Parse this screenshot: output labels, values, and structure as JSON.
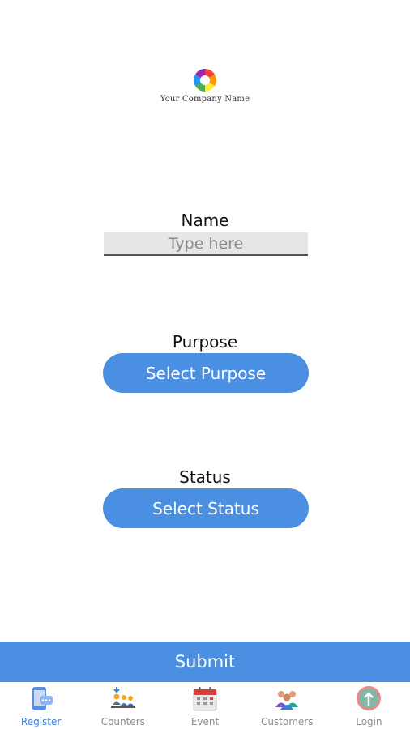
{
  "brand": {
    "company_name": "Your Company Name",
    "logo_icon": "aperture-logo-icon"
  },
  "form": {
    "name_label": "Name",
    "name_placeholder": "Type here",
    "purpose_label": "Purpose",
    "purpose_button": "Select Purpose",
    "status_label": "Status",
    "status_button": "Select Status",
    "submit_label": "Submit"
  },
  "nav": {
    "active": "Register",
    "items": [
      {
        "label": "Register",
        "icon": "phone-chat-icon"
      },
      {
        "label": "Counters",
        "icon": "counters-people-icon"
      },
      {
        "label": "Event",
        "icon": "calendar-icon"
      },
      {
        "label": "Customers",
        "icon": "customers-group-icon"
      },
      {
        "label": "Login",
        "icon": "login-arrow-icon"
      }
    ]
  },
  "colors": {
    "accent": "#4a8fe2",
    "active_nav": "#3b7ddd",
    "inactive_nav": "#8c8c8c"
  }
}
